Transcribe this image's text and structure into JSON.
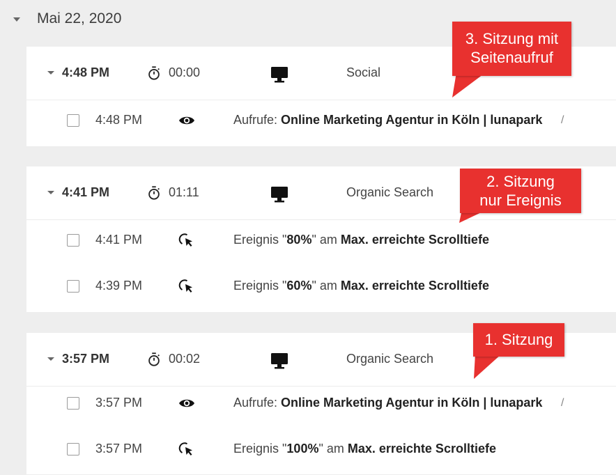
{
  "date_label": "Mai 22, 2020",
  "sessions": [
    {
      "time": "4:48 PM",
      "duration": "00:00",
      "channel": "Social",
      "device": "desktop-icon",
      "hits": [
        {
          "time": "4:48 PM",
          "type": "pageview",
          "prefix": "Aufrufe: ",
          "title": "Online Marketing Agentur in Köln | lunapark",
          "slash": "/"
        }
      ]
    },
    {
      "time": "4:41 PM",
      "duration": "01:11",
      "channel": "Organic Search",
      "device": "desktop-icon",
      "hits": [
        {
          "time": "4:41 PM",
          "type": "event",
          "prefix": "Ereignis \"",
          "value": "80%",
          "middle": "\" am ",
          "name": "Max. erreichte Scrolltiefe"
        },
        {
          "time": "4:39 PM",
          "type": "event",
          "prefix": "Ereignis \"",
          "value": "60%",
          "middle": "\" am ",
          "name": "Max. erreichte Scrolltiefe"
        }
      ]
    },
    {
      "time": "3:57 PM",
      "duration": "00:02",
      "channel": "Organic Search",
      "device": "desktop-icon",
      "hits": [
        {
          "time": "3:57 PM",
          "type": "pageview",
          "prefix": "Aufrufe: ",
          "title": "Online Marketing Agentur in Köln | lunapark",
          "slash": "/"
        },
        {
          "time": "3:57 PM",
          "type": "event",
          "prefix": "Ereignis \"",
          "value": "100%",
          "middle": "\" am ",
          "name": "Max. erreichte Scrolltiefe"
        }
      ]
    }
  ],
  "callouts": {
    "c3": {
      "line1": "3. Sitzung mit",
      "line2": "Seitenaufruf"
    },
    "c2": {
      "line1": "2. Sitzung",
      "line2": "nur Ereignis"
    },
    "c1": {
      "line1": "1. Sitzung"
    }
  },
  "colors": {
    "callout": "#e8312f",
    "background": "#eeeeee",
    "card": "#ffffff"
  }
}
